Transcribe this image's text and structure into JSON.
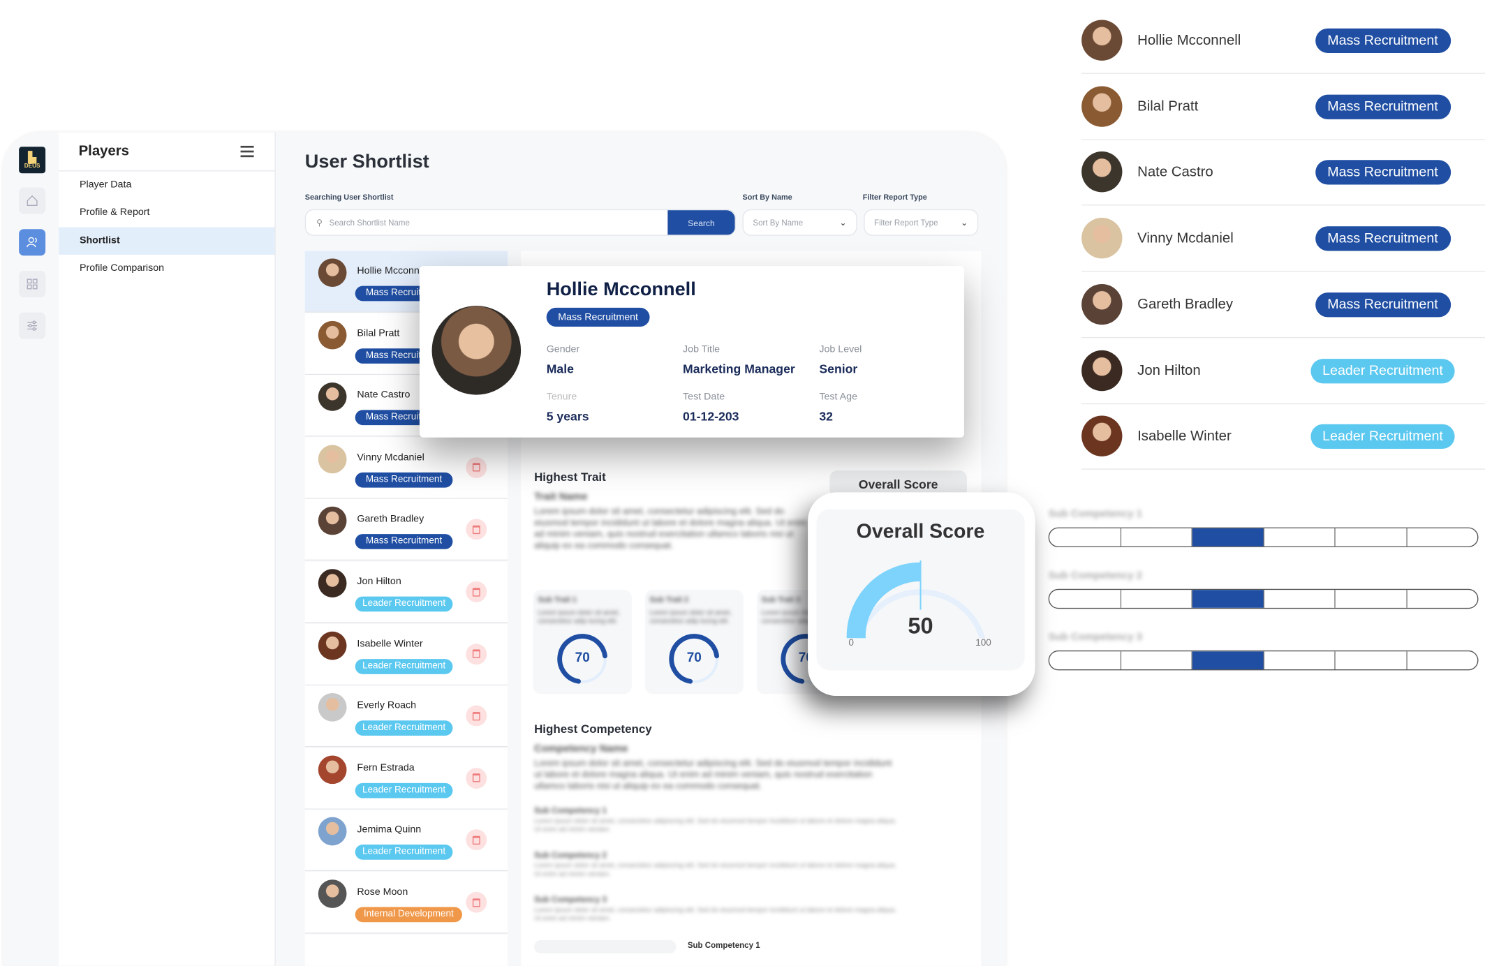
{
  "logo_text": "DEUS",
  "rail": [
    "home-icon",
    "users-icon",
    "grid-icon",
    "sliders-icon"
  ],
  "sidebar": {
    "title": "Players",
    "items": [
      {
        "label": "Player Data"
      },
      {
        "label": "Profile & Report"
      },
      {
        "label": "Shortlist",
        "active": true
      },
      {
        "label": "Profile Comparison"
      }
    ]
  },
  "main": {
    "title": "User Shortlist",
    "search_label": "Searching User Shortlist",
    "search_placeholder": "Search Shortlist Name",
    "search_button": "Search",
    "sort_label": "Sort By Name",
    "sort_value": "Sort By Name",
    "filter_label": "Filter Report Type",
    "filter_value": "Filter Report Type"
  },
  "colors": {
    "mass": "#1f4ea3",
    "leader": "#5bc8f0",
    "internal": "#f0984a",
    "accent": "#1f4ea3"
  },
  "players": [
    {
      "name": "Hollie Mcconnell",
      "type": "Mass Recruitment",
      "kind": "mass",
      "avatar": "#6b4a35"
    },
    {
      "name": "Bilal Pratt",
      "type": "Mass Recruitment",
      "kind": "mass",
      "avatar": "#8a5a32"
    },
    {
      "name": "Nate Castro",
      "type": "Mass Recruitment",
      "kind": "mass",
      "avatar": "#3b352c"
    },
    {
      "name": "Vinny Mcdaniel",
      "type": "Mass Recruitment",
      "kind": "mass",
      "avatar": "#d9c3a0"
    },
    {
      "name": "Gareth Bradley",
      "type": "Mass Recruitment",
      "kind": "mass",
      "avatar": "#5a4336"
    },
    {
      "name": "Jon Hilton",
      "type": "Leader Recruitment",
      "kind": "leader",
      "avatar": "#3a2a22"
    },
    {
      "name": "Isabelle Winter",
      "type": "Leader Recruitment",
      "kind": "leader",
      "avatar": "#6b3520"
    },
    {
      "name": "Everly Roach",
      "type": "Leader Recruitment",
      "kind": "leader",
      "avatar": "#c9c9c9"
    },
    {
      "name": "Fern Estrada",
      "type": "Leader Recruitment",
      "kind": "leader",
      "avatar": "#a4462e"
    },
    {
      "name": "Jemima Quinn",
      "type": "Leader Recruitment",
      "kind": "leader",
      "avatar": "#7ea3cf"
    },
    {
      "name": "Rose Moon",
      "type": "Internal Development",
      "kind": "internal",
      "avatar": "#555"
    }
  ],
  "profile_card": {
    "name": "Hollie Mcconnell",
    "badge": "Mass Recruitment",
    "fields": [
      {
        "label": "Gender",
        "value": "Male"
      },
      {
        "label": "Job Title",
        "value": "Marketing Manager"
      },
      {
        "label": "Job Level",
        "value": "Senior"
      },
      {
        "label": "Tenure",
        "value": "5 years"
      },
      {
        "label": "Test Date",
        "value": "01-12-203"
      },
      {
        "label": "Test Age",
        "value": "32"
      }
    ]
  },
  "detail": {
    "highest_trait": "Highest Trait",
    "trait_name": "Trait Name",
    "trait_desc": "Lorem ipsum dolor sit amet, consectetur adipiscing elit. Sed do eiusmod tempor incididunt ut labore et dolore magna aliqua. Ut enim ad minim veniam, quis nostrud exercitation ullamco laboris nisi ut aliquip ex ea commodo consequat.",
    "overall_score_label": "Overall Score",
    "sub_traits": [
      {
        "name": "Sub Trait 1",
        "desc": "Lorem ipsum dolor sit amet, consectetur adip iscing elit.",
        "score": 70
      },
      {
        "name": "Sub Trait 2",
        "desc": "Lorem ipsum dolor sit amet, consectetur adip iscing elit.",
        "score": 70
      },
      {
        "name": "Sub Trait 3",
        "desc": "Lorem ipsum dolor sit amet, consectetur adip iscing elit.",
        "score": 70
      }
    ],
    "highest_competency": "Highest Competency",
    "competency_name": "Competency Name",
    "competency_desc": "Lorem ipsum dolor sit amet, consectetur adipiscing elit. Sed do eiusmod tempor incididunt ut labore et dolore magna aliqua. Ut enim ad minim veniam, quis nostrud exercitation ullamco laboris nisi ut aliquip ex ea commodo consequat.",
    "sub_competencies": [
      {
        "name": "Sub Competency 1",
        "desc": "Lorem ipsum dolor sit amet, consectetur adipiscing elit. Sed do eiusmod tempor incididunt ut labore et dolore magna aliqua. Ut enim ad minim veniam."
      },
      {
        "name": "Sub Competency 2",
        "desc": "Lorem ipsum dolor sit amet, consectetur adipiscing elit. Sed do eiusmod tempor incididunt ut labore et dolore magna aliqua. Ut enim ad minim veniam."
      },
      {
        "name": "Sub Competency 3",
        "desc": "Lorem ipsum dolor sit amet, consectetur adipiscing elit. Sed do eiusmod tempor incididunt ut labore et dolore magna aliqua. Ut enim ad minim veniam."
      }
    ],
    "bottom_label": "Sub Competency 1"
  },
  "overall_score": {
    "title": "Overall Score",
    "value": 50,
    "min": "0",
    "max": "100"
  },
  "competency_levels": [
    {
      "name": "Sub Competency 1",
      "level": 3,
      "segments": 6
    },
    {
      "name": "Sub Competency 2",
      "level": 3,
      "segments": 6
    },
    {
      "name": "Sub Competency 3",
      "level": 3,
      "segments": 6
    }
  ]
}
